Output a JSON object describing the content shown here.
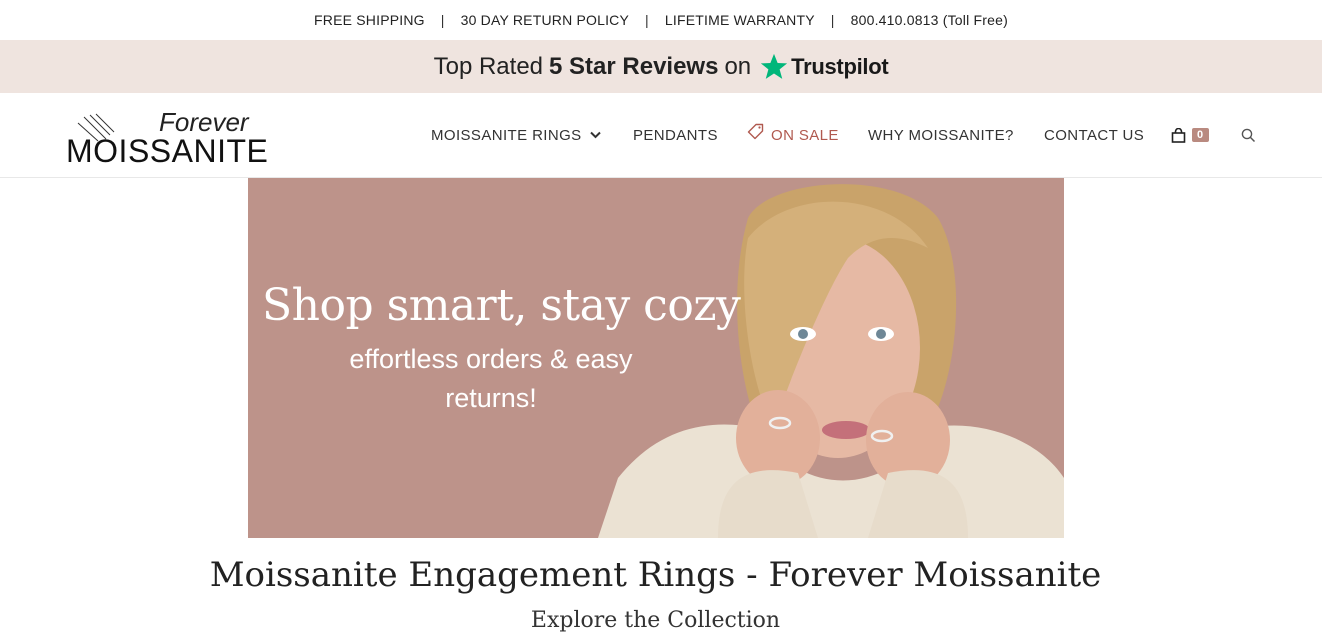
{
  "topbar": {
    "items": [
      "FREE SHIPPING",
      "30 DAY RETURN POLICY",
      "LIFETIME WARRANTY",
      "800.410.0813 (Toll Free)"
    ],
    "separator": "|"
  },
  "trustpilot_banner": {
    "prefix": "Top Rated",
    "bold": "5 Star Reviews",
    "on": "on",
    "brand": "Trustpilot",
    "star_color": "#00b67a",
    "background": "#efe4df"
  },
  "logo": {
    "line1": "Forever",
    "line2": "MOISSANITE"
  },
  "nav": {
    "items": [
      {
        "label": "MOISSANITE RINGS",
        "icon": "chevron-down-icon"
      },
      {
        "label": "PENDANTS"
      },
      {
        "label": "ON SALE",
        "icon": "tag-icon",
        "color": "#b0594f"
      },
      {
        "label": "WHY MOISSANITE?"
      },
      {
        "label": "CONTACT US"
      }
    ],
    "cart_count": "0",
    "cart_icon": "shopping-bag-icon",
    "search_icon": "search-icon"
  },
  "hero": {
    "title": "Shop smart, stay cozy",
    "subtitle": "effortless orders & easy returns!",
    "background": "#bd938a"
  },
  "main": {
    "title": "Moissanite Engagement Rings - Forever Moissanite",
    "subtitle": "Explore the Collection"
  }
}
